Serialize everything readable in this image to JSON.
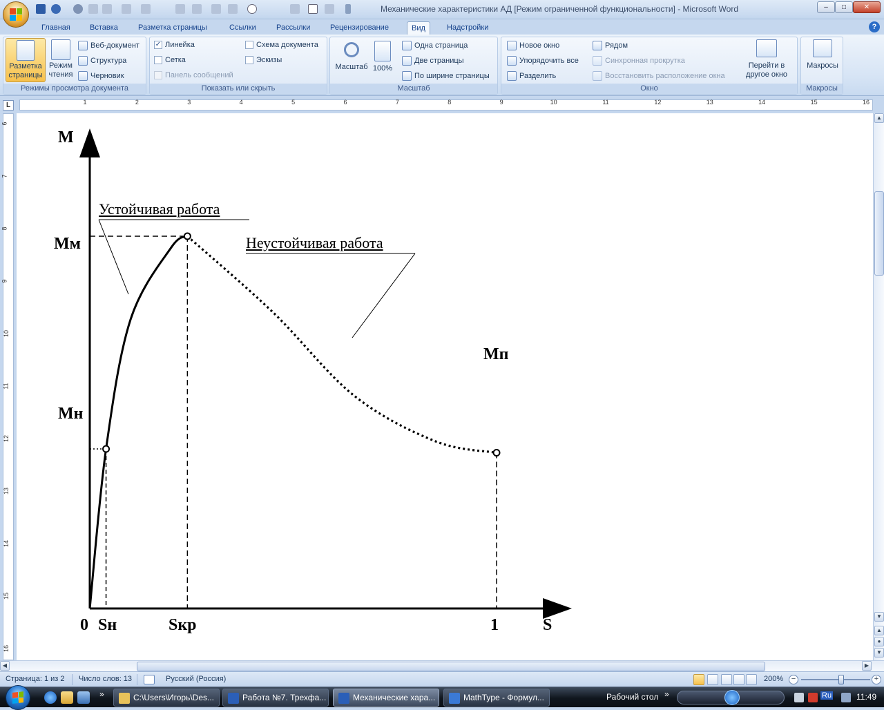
{
  "window": {
    "title": "Механические характеристики АД [Режим ограниченной функциональности] - Microsoft Word",
    "minimize": "–",
    "maximize": "□",
    "close": "✕"
  },
  "tabs": [
    "Главная",
    "Вставка",
    "Разметка страницы",
    "Ссылки",
    "Рассылки",
    "Рецензирование",
    "Вид",
    "Надстройки"
  ],
  "active_tab": "Вид",
  "help": "?",
  "ribbon": {
    "views": {
      "label": "Режимы просмотра документа",
      "print_layout": "Разметка страницы",
      "reading_mode": "Режим чтения",
      "web": "Веб-документ",
      "outline": "Структура",
      "draft": "Черновик"
    },
    "show_hide": {
      "label": "Показать или скрыть",
      "ruler": "Линейка",
      "ruler_checked": true,
      "gridlines": "Сетка",
      "message_bar": "Панель сообщений",
      "doc_map": "Схема документа",
      "thumbnails": "Эскизы",
      "check_mark": "✓"
    },
    "zoom": {
      "label": "Масштаб",
      "zoom": "Масштаб",
      "hundred": "100%",
      "one_page": "Одна страница",
      "two_pages": "Две страницы",
      "page_width": "По ширине страницы"
    },
    "window": {
      "label": "Окно",
      "new_window": "Новое окно",
      "arrange_all": "Упорядочить все",
      "split": "Разделить",
      "side_by_side": "Рядом",
      "sync_scroll": "Синхронная прокрутка",
      "reset_position": "Восстановить расположение окна",
      "switch_windows": "Перейти в другое окно"
    },
    "macros": {
      "label": "Макросы",
      "macros": "Макросы"
    }
  },
  "ruler": {
    "corner": "L",
    "h_numbers": [
      "1",
      "2",
      "3",
      "4",
      "5",
      "6",
      "7",
      "8",
      "9",
      "10",
      "11",
      "12",
      "13",
      "14",
      "15",
      "16"
    ],
    "v_numbers": [
      "6",
      "7",
      "8",
      "9",
      "10",
      "11",
      "12",
      "13",
      "14",
      "15",
      "16"
    ]
  },
  "document": {
    "chart_data": {
      "type": "line",
      "xlabel": "S",
      "ylabel": "M",
      "x_ticks": [
        "0",
        "Sн",
        "Sкр",
        "1"
      ],
      "y_ticks": [
        "Mн",
        "Mм"
      ],
      "annotations": [
        "Устойчивая работа",
        "Неустойчивая работа"
      ],
      "point_labels": [
        "Mп"
      ],
      "series": [
        {
          "style": "solid",
          "segment": "stable",
          "points": [
            [
              0,
              0
            ],
            [
              0.04,
              0.42
            ],
            [
              0.1,
              0.76
            ],
            [
              0.2,
              0.95
            ],
            [
              0.24,
              0.98
            ]
          ]
        },
        {
          "style": "dotted",
          "segment": "unstable",
          "points": [
            [
              0.24,
              0.98
            ],
            [
              0.45,
              0.78
            ],
            [
              0.65,
              0.56
            ],
            [
              0.85,
              0.44
            ],
            [
              1.0,
              0.41
            ]
          ]
        }
      ],
      "markers": [
        {
          "x": 0.04,
          "y": 0.42,
          "label": "Mн"
        },
        {
          "x": 0.24,
          "y": 0.98,
          "label": "Mм"
        },
        {
          "x": 1.0,
          "y": 0.41,
          "label": "Mп"
        }
      ],
      "grid": false
    },
    "labels": {
      "M": "M",
      "M_m": "Mм",
      "M_n": "Mн",
      "M_p": "Mп",
      "zero": "0",
      "S_n": "Sн",
      "S_kr": "Sкр",
      "one": "1",
      "S": "S",
      "stable": "Устойчивая работа",
      "unstable": "Неустойчивая работа"
    }
  },
  "status": {
    "page": "Страница: 1 из 2",
    "words": "Число слов: 13",
    "language": "Русский (Россия)",
    "zoom": "200%",
    "zoom_minus": "−",
    "zoom_plus": "+"
  },
  "taskbar": {
    "items": [
      {
        "label": "C:\\Users\\Игорь\\Des...",
        "color": "#e8c25a"
      },
      {
        "label": "Работа №7. Трехфа...",
        "color": "#2b5fb8"
      },
      {
        "label": "Механические хара...",
        "color": "#2b5fb8"
      },
      {
        "label": "MathType - Формул...",
        "color": "#3b7ad6"
      }
    ],
    "desktop": "Рабочий стол",
    "more": "»",
    "lang": "Ru",
    "clock": "11:49"
  },
  "colors": {
    "ribbon_accent": "#f7c14c",
    "title_text": "#3e4f6b",
    "chart_ink": "#000000"
  }
}
